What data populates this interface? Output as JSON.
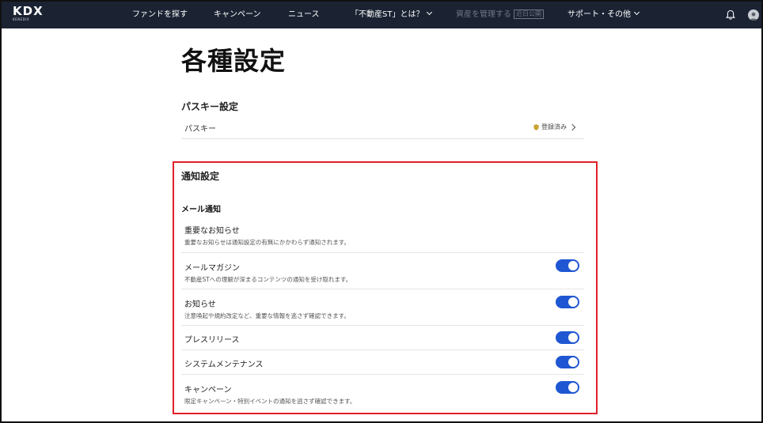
{
  "header": {
    "logo": "KDX",
    "logo_sub": "KENEDIX",
    "nav": [
      {
        "label": "ファンドを探す"
      },
      {
        "label": "キャンペーン"
      },
      {
        "label": "ニュース"
      },
      {
        "label": "「不動産ST」とは？"
      },
      {
        "label": "資産を管理する",
        "badge": "近日公開"
      },
      {
        "label": "サポート・その他"
      }
    ]
  },
  "page": {
    "title": "各種設定"
  },
  "passkey": {
    "section_title": "パスキー設定",
    "row_label": "パスキー",
    "status": "登録済み"
  },
  "notifications": {
    "section_title": "通知設定",
    "subsection_title": "メール通知",
    "items": [
      {
        "label": "重要なお知らせ",
        "description": "重要なお知らせは通知設定の有無にかかわらず通知されます。"
      },
      {
        "label": "メールマガジン",
        "description": "不動産STへの理解が深まるコンテンツの通知を受け取れます。",
        "enabled": true
      },
      {
        "label": "お知らせ",
        "description": "注意喚起や規約改定など、重要な情報を逃さず確認できます。",
        "enabled": true
      },
      {
        "label": "プレスリリース",
        "enabled": true
      },
      {
        "label": "システムメンテナンス",
        "enabled": true
      },
      {
        "label": "キャンペーン",
        "description": "限定キャンペーン・特別イベントの通知を逃さず確認できます。",
        "enabled": true
      }
    ]
  },
  "colors": {
    "navbar_bg": "#1b2333",
    "toggle_on": "#1f57d3",
    "highlight_border": "#e0202a"
  }
}
